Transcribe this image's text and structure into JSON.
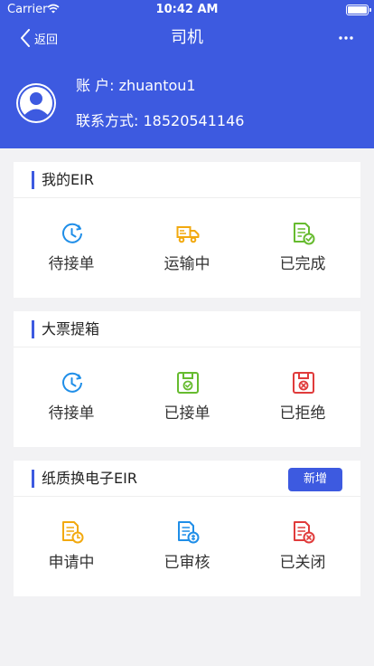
{
  "status_bar": {
    "carrier": "Carrier",
    "time": "10:42 AM"
  },
  "nav": {
    "back_label": "返回",
    "title": "司机"
  },
  "profile": {
    "account": "账 户: zhuantou1",
    "contact": "联系方式: 18520541146"
  },
  "colors": {
    "primary": "#3d5ae0",
    "blue": "#1f8ee8",
    "orange": "#f2a90f",
    "green": "#66bb2f",
    "red": "#e03b3b"
  },
  "sections": [
    {
      "title": "我的EIR",
      "tiles": [
        {
          "label": "待接单",
          "icon": "clock-icon"
        },
        {
          "label": "运输中",
          "icon": "truck-icon"
        },
        {
          "label": "已完成",
          "icon": "document-check-icon"
        }
      ]
    },
    {
      "title": "大票提箱",
      "tiles": [
        {
          "label": "待接单",
          "icon": "clock-icon"
        },
        {
          "label": "已接单",
          "icon": "box-check-icon"
        },
        {
          "label": "已拒绝",
          "icon": "box-reject-icon"
        }
      ]
    },
    {
      "title": "纸质换电子EIR",
      "add_label": "新增",
      "tiles": [
        {
          "label": "申请中",
          "icon": "document-pending-icon"
        },
        {
          "label": "已审核",
          "icon": "document-reviewed-icon"
        },
        {
          "label": "已关闭",
          "icon": "document-closed-icon"
        }
      ]
    }
  ]
}
